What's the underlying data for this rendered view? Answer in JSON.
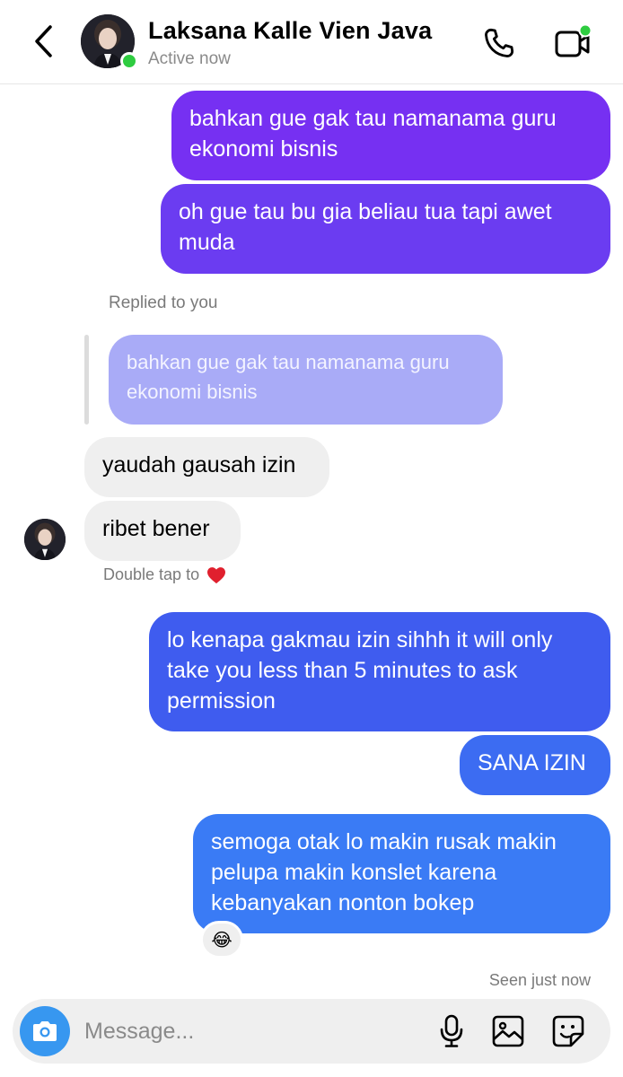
{
  "header": {
    "contact_name": "Laksana Kalle Vien Java",
    "status": "Active now",
    "icons": [
      "back-chevron-icon",
      "phone-icon",
      "video-call-icon"
    ]
  },
  "messages": [
    {
      "direction": "out",
      "text": "bahkan gue gak tau namanama guru\nekonomi bisnis"
    },
    {
      "direction": "out",
      "text": "oh gue tau bu gia beliau tua tapi awet\nmuda"
    },
    {
      "reply_label": "Replied to you",
      "quoted_text": "bahkan gue gak tau namanama guru\nekonomi bisnis"
    },
    {
      "direction": "in",
      "text": "yaudah gausah izin"
    },
    {
      "direction": "in",
      "text": "ribet bener"
    },
    {
      "hint": "Double tap to",
      "hint_icon": "red-heart-icon"
    },
    {
      "direction": "out",
      "text": "lo kenapa gakmau izin sihhh it will only\ntake you less than 5 minutes to ask\npermission"
    },
    {
      "direction": "out",
      "text": "SANA IZIN"
    },
    {
      "direction": "out",
      "text": "semoga otak lo makin rusak makin\npelupa makin konslet karena\nkebanyakan nonton bokep",
      "reaction": "😂"
    }
  ],
  "seen_label": "Seen just now",
  "composer": {
    "placeholder": "Message...",
    "icons": [
      "camera-icon",
      "microphone-icon",
      "gallery-icon",
      "sticker-icon"
    ]
  },
  "colors": {
    "out_gradient": [
      "#7b2ff2",
      "#3f5bef",
      "#3a7bf5"
    ],
    "quoted_bubble": "#a9abf7",
    "incoming_bubble": "#efefef",
    "online": "#2ecc40",
    "camera_button": "#3797f0"
  }
}
